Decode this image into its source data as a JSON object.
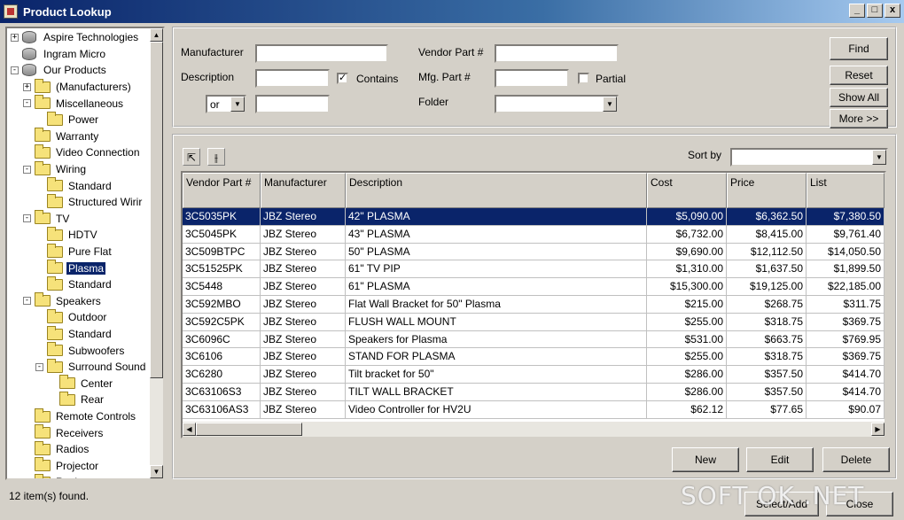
{
  "window": {
    "title": "Product Lookup",
    "btn_min": "_",
    "btn_max": "□",
    "btn_close": "x"
  },
  "tree": {
    "nodes": [
      {
        "label": "Aspire Technologies",
        "depth": 0,
        "exp": "+",
        "icon": "db"
      },
      {
        "label": "Ingram Micro",
        "depth": 0,
        "exp": "",
        "icon": "db"
      },
      {
        "label": "Our Products",
        "depth": 0,
        "exp": "-",
        "icon": "db"
      },
      {
        "label": "(Manufacturers)",
        "depth": 1,
        "exp": "+",
        "icon": "folder"
      },
      {
        "label": "Miscellaneous",
        "depth": 1,
        "exp": "-",
        "icon": "folder"
      },
      {
        "label": "Power",
        "depth": 2,
        "exp": "",
        "icon": "folder"
      },
      {
        "label": "Warranty",
        "depth": 1,
        "exp": "",
        "icon": "folder"
      },
      {
        "label": "Video Connection",
        "depth": 1,
        "exp": "",
        "icon": "folder"
      },
      {
        "label": "Wiring",
        "depth": 1,
        "exp": "-",
        "icon": "folder"
      },
      {
        "label": "Standard",
        "depth": 2,
        "exp": "",
        "icon": "folder"
      },
      {
        "label": "Structured Wirir",
        "depth": 2,
        "exp": "",
        "icon": "folder"
      },
      {
        "label": "TV",
        "depth": 1,
        "exp": "-",
        "icon": "folder"
      },
      {
        "label": "HDTV",
        "depth": 2,
        "exp": "",
        "icon": "folder"
      },
      {
        "label": "Pure Flat",
        "depth": 2,
        "exp": "",
        "icon": "folder"
      },
      {
        "label": "Plasma",
        "depth": 2,
        "exp": "",
        "icon": "folder",
        "selected": true
      },
      {
        "label": "Standard",
        "depth": 2,
        "exp": "",
        "icon": "folder"
      },
      {
        "label": "Speakers",
        "depth": 1,
        "exp": "-",
        "icon": "folder"
      },
      {
        "label": "Outdoor",
        "depth": 2,
        "exp": "",
        "icon": "folder"
      },
      {
        "label": "Standard",
        "depth": 2,
        "exp": "",
        "icon": "folder"
      },
      {
        "label": "Subwoofers",
        "depth": 2,
        "exp": "",
        "icon": "folder"
      },
      {
        "label": "Surround Sound",
        "depth": 2,
        "exp": "-",
        "icon": "folder"
      },
      {
        "label": "Center",
        "depth": 3,
        "exp": "",
        "icon": "folder"
      },
      {
        "label": "Rear",
        "depth": 3,
        "exp": "",
        "icon": "folder"
      },
      {
        "label": "Remote Controls",
        "depth": 1,
        "exp": "",
        "icon": "folder"
      },
      {
        "label": "Receivers",
        "depth": 1,
        "exp": "",
        "icon": "folder"
      },
      {
        "label": "Radios",
        "depth": 1,
        "exp": "",
        "icon": "folder"
      },
      {
        "label": "Projector",
        "depth": 1,
        "exp": "",
        "icon": "folder"
      },
      {
        "label": "Racks",
        "depth": 1,
        "exp": "",
        "icon": "folder"
      }
    ]
  },
  "search": {
    "manufacturer_label": "Manufacturer",
    "description_label": "Description",
    "contains_label": "Contains",
    "contains_check": "✓",
    "or_value": "or",
    "vendor_part_label": "Vendor Part #",
    "mfg_part_label": "Mfg. Part #",
    "partial_label": "Partial",
    "folder_label": "Folder",
    "manufacturer_value": "",
    "description_value": "",
    "description2_value": "",
    "vendor_part_value": "",
    "mfg_part_value": "",
    "folder_value": "",
    "find_label": "Find",
    "reset_label": "Reset",
    "show_all_label": "Show All",
    "more_label": "More >>"
  },
  "results": {
    "sort_by_label": "Sort by",
    "sort_by_value": "",
    "columns": [
      "Vendor Part #",
      "Manufacturer",
      "Description",
      "Cost",
      "Price",
      "List"
    ],
    "rows": [
      [
        "3C5035PK",
        "JBZ Stereo",
        "42\" PLASMA",
        "$5,090.00",
        "$6,362.50",
        "$7,380.50"
      ],
      [
        "3C5045PK",
        "JBZ Stereo",
        "43\" PLASMA",
        "$6,732.00",
        "$8,415.00",
        "$9,761.40"
      ],
      [
        "3C509BTPC",
        "JBZ Stereo",
        "50\" PLASMA",
        "$9,690.00",
        "$12,112.50",
        "$14,050.50"
      ],
      [
        "3C51525PK",
        "JBZ Stereo",
        "61\" TV PIP",
        "$1,310.00",
        "$1,637.50",
        "$1,899.50"
      ],
      [
        "3C5448",
        "JBZ Stereo",
        "61\" PLASMA",
        "$15,300.00",
        "$19,125.00",
        "$22,185.00"
      ],
      [
        "3C592MBO",
        "JBZ Stereo",
        "Flat Wall Bracket for 50\" Plasma",
        "$215.00",
        "$268.75",
        "$311.75"
      ],
      [
        "3C592C5PK",
        "JBZ Stereo",
        "FLUSH WALL MOUNT",
        "$255.00",
        "$318.75",
        "$369.75"
      ],
      [
        "3C6096C",
        "JBZ Stereo",
        "Speakers for Plasma",
        "$531.00",
        "$663.75",
        "$769.95"
      ],
      [
        "3C6106",
        "JBZ Stereo",
        "STAND FOR PLASMA",
        "$255.00",
        "$318.75",
        "$369.75"
      ],
      [
        "3C6280",
        "JBZ Stereo",
        "Tilt bracket for 50\"",
        "$286.00",
        "$357.50",
        "$414.70"
      ],
      [
        "3C63106S3",
        "JBZ Stereo",
        "TILT WALL BRACKET",
        "$286.00",
        "$357.50",
        "$414.70"
      ],
      [
        "3C63106AS3",
        "JBZ Stereo",
        "Video Controller for HV2U",
        "$62.12",
        "$77.65",
        "$90.07"
      ]
    ],
    "new_label": "New",
    "edit_label": "Edit",
    "delete_label": "Delete"
  },
  "status": {
    "text": "12 item(s) found.",
    "select_label": "Select/Add",
    "close_label": "Close"
  },
  "watermark": "SOFT OK .NET"
}
